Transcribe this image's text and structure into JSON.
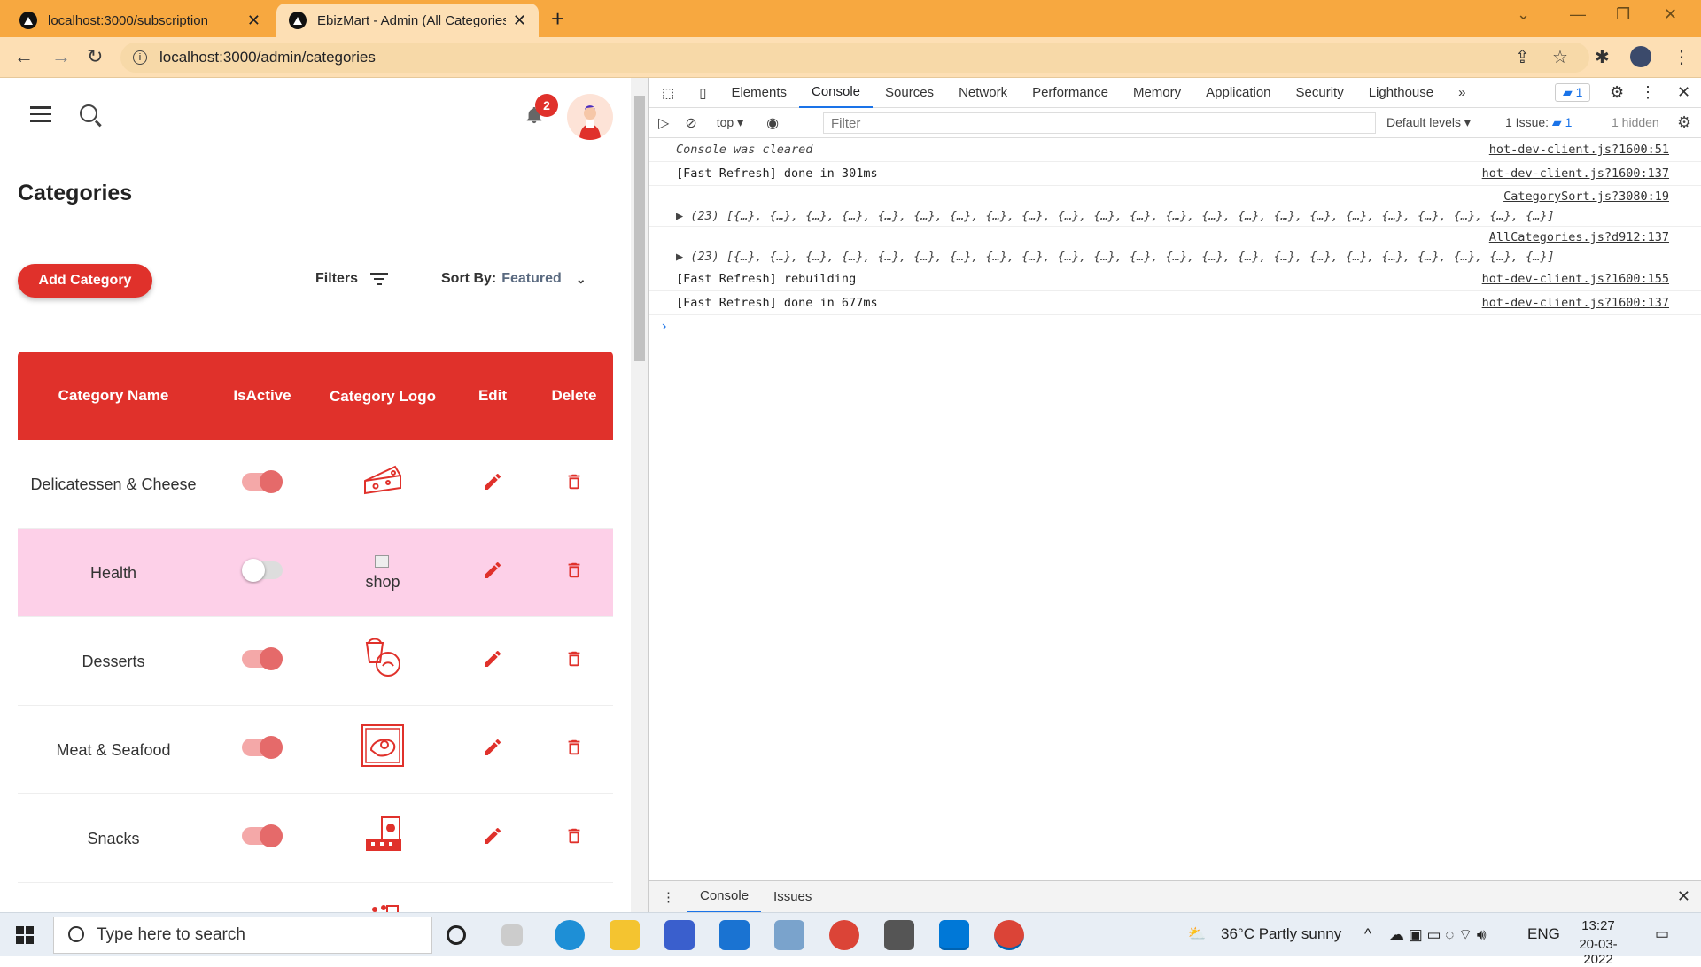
{
  "browser": {
    "tabs": [
      {
        "title": "localhost:3000/subscription"
      },
      {
        "title": "EbizMart - Admin (All Categories)"
      }
    ],
    "url": "localhost:3000/admin/categories"
  },
  "page": {
    "notifications_count": "2",
    "title": "Categories",
    "add_button": "Add Category",
    "filters_label": "Filters",
    "sort_label": "Sort By:",
    "sort_value": "Featured",
    "table": {
      "headers": [
        "Category Name",
        "IsActive",
        "Category Logo",
        "Edit",
        "Delete"
      ],
      "rows": [
        {
          "name": "Delicatessen & Cheese",
          "active": true,
          "logo": "cheese-icon"
        },
        {
          "name": "Health",
          "active": false,
          "logo_alt": "shop"
        },
        {
          "name": "Desserts",
          "active": true,
          "logo": "dessert-icon"
        },
        {
          "name": "Meat & Seafood",
          "active": true,
          "logo": "meat-icon"
        },
        {
          "name": "Snacks",
          "active": true,
          "logo": "snacks-icon"
        }
      ]
    }
  },
  "devtools": {
    "tabs": [
      "Elements",
      "Console",
      "Sources",
      "Network",
      "Performance",
      "Memory",
      "Application",
      "Security",
      "Lighthouse"
    ],
    "active_tab": "Console",
    "issues_badge": "1",
    "context": "top",
    "filter_placeholder": "Filter",
    "levels": "Default levels",
    "issues_count": "1 Issue:",
    "issues_num": "1",
    "hidden": "1 hidden",
    "console": [
      {
        "text": "Console was cleared",
        "src": "hot-dev-client.js?1600:51",
        "italic": true
      },
      {
        "text": "[Fast Refresh] done in 301ms",
        "src": "hot-dev-client.js?1600:137"
      },
      {
        "text": "▶ (23) [{…}, {…}, {…}, {…}, {…}, {…}, {…}, {…}, {…}, {…}, {…}, {…}, {…}, {…}, {…}, {…}, {…}, {…}, {…}, {…}, {…}, {…}, {…}]",
        "src": "CategorySort.js?3080:19",
        "tall": true
      },
      {
        "text": "▶ (23) [{…}, {…}, {…}, {…}, {…}, {…}, {…}, {…}, {…}, {…}, {…}, {…}, {…}, {…}, {…}, {…}, {…}, {…}, {…}, {…}, {…}, {…}, {…}]",
        "src": "AllCategories.js?d912:137",
        "tall": true
      },
      {
        "text": "[Fast Refresh] rebuilding",
        "src": "hot-dev-client.js?1600:155"
      },
      {
        "text": "[Fast Refresh] done in 677ms",
        "src": "hot-dev-client.js?1600:137"
      }
    ],
    "drawer_tabs": [
      "Console",
      "Issues"
    ]
  },
  "taskbar": {
    "search_placeholder": "Type here to search",
    "weather": "36°C  Partly sunny",
    "lang": "ENG",
    "time": "13:27",
    "date": "20-03-2022"
  },
  "colors": {
    "accent": "#e0312b",
    "tabstrip": "#f7a840",
    "pink_row": "#fdd0e8"
  }
}
